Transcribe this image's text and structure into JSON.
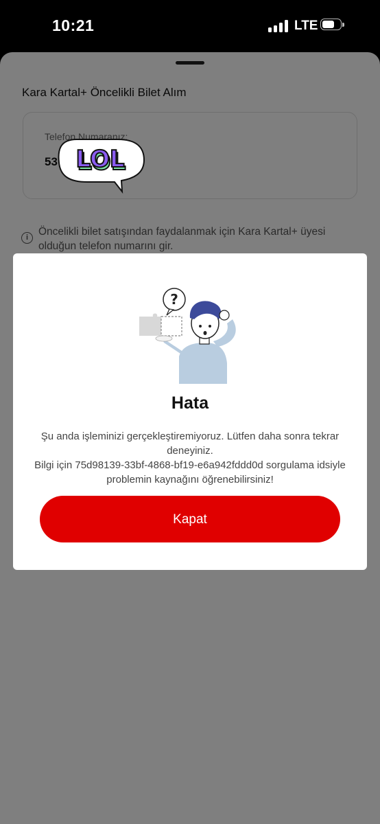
{
  "status_bar": {
    "time": "10:21",
    "network": "LTE",
    "battery_level": 0.6
  },
  "sheet": {
    "title": "Kara Kartal+ Öncelikli Bilet Alım",
    "phone_label": "Telefon Numaranız:",
    "phone_value": "53",
    "info_text": "Öncelikli bilet satışından faydalanmak için Kara Kartal+ üyesi olduğun telefon numarını gir."
  },
  "sticker": {
    "text": "LOL"
  },
  "modal": {
    "title": "Hata",
    "message_line1": "Şu anda işleminizi gerçekleştiremiyoruz. Lütfen daha sonra tekrar deneyiniz.",
    "message_line2": "Bilgi için 75d98139-33bf-4868-bf19-e6a942fddd0d sorgulama idsiyle problemin kaynağını öğrenebilirsiniz!",
    "close_label": "Kapat"
  },
  "colors": {
    "accent": "#e00000",
    "sticker_purple": "#8a5cf0",
    "sticker_green": "#7be0a4"
  }
}
